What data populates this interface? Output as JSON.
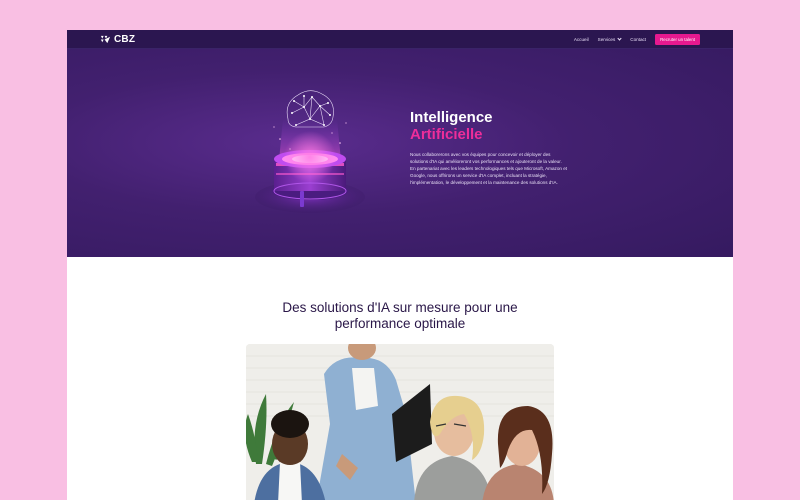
{
  "nav": {
    "logo_text": "CBZ",
    "links": [
      "Accueil",
      "Services",
      "Contact"
    ],
    "cta_label": "Recruter un talent"
  },
  "hero": {
    "title_line1": "Intelligence",
    "title_line2": "Artificielle",
    "description": "Nous collaborerons avec vos équipes pour concevoir et déployer des solutions d'IA qui amélioreront vos performances et ajouteront de la valeur. En partenariat avec les leaders technologiques tels que Microsoft, Amazon et Google, nous offrirons un service d'IA complet, incluant la stratégie, l'implémentation, le développement et la maintenance des solutions d'IA."
  },
  "section": {
    "title_line1": "Des solutions d'IA sur mesure pour une",
    "title_line2": "performance optimale"
  },
  "colors": {
    "accent": "#e6198f",
    "hero_bg": "#42206f",
    "nav_bg": "#2b1650",
    "page_bg": "#f9bfe3"
  }
}
